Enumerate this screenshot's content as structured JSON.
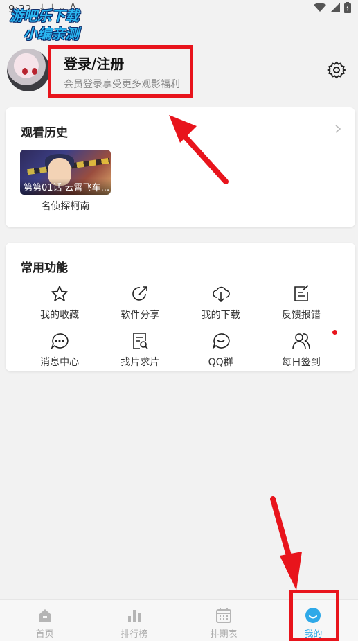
{
  "status_bar": {
    "time": "9:32",
    "icons": [
      "download-icon",
      "download-icon",
      "download-icon",
      "a-icon"
    ],
    "right_icons": [
      "wifi-icon",
      "signal-icon",
      "battery-icon"
    ]
  },
  "watermark": {
    "line1": "游吧乐下载",
    "line2": "小编亲测"
  },
  "header": {
    "title": "登录/注册",
    "subtitle": "会员登录享受更多观影福利"
  },
  "history": {
    "title": "观看历史",
    "items": [
      {
        "caption": "第第01话 云霄飞车...",
        "name": "名侦探柯南"
      }
    ]
  },
  "functions": {
    "title": "常用功能",
    "items": [
      {
        "label": "我的收藏",
        "icon": "star-icon"
      },
      {
        "label": "软件分享",
        "icon": "share-icon"
      },
      {
        "label": "我的下载",
        "icon": "cloud-download-icon"
      },
      {
        "label": "反馈报错",
        "icon": "edit-icon"
      },
      {
        "label": "消息中心",
        "icon": "chat-bubble-icon"
      },
      {
        "label": "找片求片",
        "icon": "search-doc-icon"
      },
      {
        "label": "QQ群",
        "icon": "group-chat-icon"
      },
      {
        "label": "每日签到",
        "icon": "users-icon"
      }
    ]
  },
  "bottom_nav": {
    "items": [
      {
        "label": "首页",
        "icon": "home-icon"
      },
      {
        "label": "排行榜",
        "icon": "bar-chart-icon"
      },
      {
        "label": "排期表",
        "icon": "calendar-icon"
      },
      {
        "label": "我的",
        "icon": "smile-icon",
        "active": true
      }
    ]
  },
  "colors": {
    "accent": "#2fa9e8",
    "highlight": "#e8141c",
    "background": "#f2f2f2"
  }
}
